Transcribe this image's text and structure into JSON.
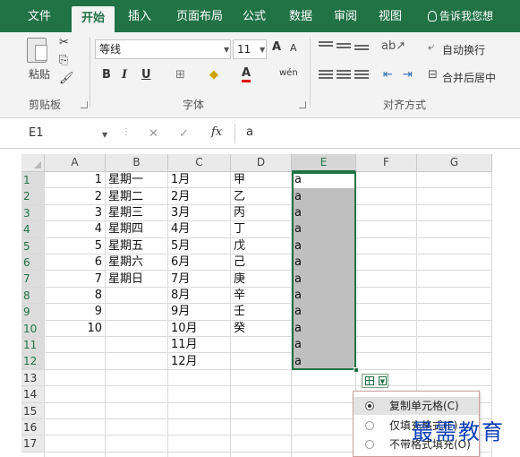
{
  "ribbon_tabs": [
    {
      "label": "文件"
    },
    {
      "label": "开始",
      "active": true
    },
    {
      "label": "插入"
    },
    {
      "label": "页面布局"
    },
    {
      "label": "公式"
    },
    {
      "label": "数据"
    },
    {
      "label": "审阅"
    },
    {
      "label": "视图"
    }
  ],
  "tell_me": "告诉我您想",
  "clipboard": {
    "paste_label": "粘贴",
    "group_label": "剪贴板"
  },
  "font": {
    "name": "等线",
    "size": "11",
    "group_label": "字体",
    "bold": "B",
    "italic": "I",
    "underline": "U",
    "grow": "A",
    "shrink": "A",
    "color_letter": "A",
    "phonetic": "wén"
  },
  "alignment": {
    "wrap_text": "自动换行",
    "merge_center": "合并后居中",
    "group_label": "对齐方式"
  },
  "formula_bar": {
    "name_box": "E1",
    "fx": "fx",
    "value": "a"
  },
  "columns": [
    "A",
    "B",
    "C",
    "D",
    "E",
    "F",
    "G"
  ],
  "selected_column": "E",
  "rows": [
    {
      "n": "1",
      "a": "1",
      "b": "星期一",
      "c": "1月",
      "d": "甲",
      "e": "a"
    },
    {
      "n": "2",
      "a": "2",
      "b": "星期二",
      "c": "2月",
      "d": "乙",
      "e": "a"
    },
    {
      "n": "3",
      "a": "3",
      "b": "星期三",
      "c": "3月",
      "d": "丙",
      "e": "a"
    },
    {
      "n": "4",
      "a": "4",
      "b": "星期四",
      "c": "4月",
      "d": "丁",
      "e": "a"
    },
    {
      "n": "5",
      "a": "5",
      "b": "星期五",
      "c": "5月",
      "d": "戊",
      "e": "a"
    },
    {
      "n": "6",
      "a": "6",
      "b": "星期六",
      "c": "6月",
      "d": "己",
      "e": "a"
    },
    {
      "n": "7",
      "a": "7",
      "b": "星期日",
      "c": "7月",
      "d": "庚",
      "e": "a"
    },
    {
      "n": "8",
      "a": "8",
      "b": "",
      "c": "8月",
      "d": "辛",
      "e": "a"
    },
    {
      "n": "9",
      "a": "9",
      "b": "",
      "c": "9月",
      "d": "壬",
      "e": "a"
    },
    {
      "n": "10",
      "a": "10",
      "b": "",
      "c": "10月",
      "d": "癸",
      "e": "a"
    },
    {
      "n": "11",
      "a": "",
      "b": "",
      "c": "11月",
      "d": "",
      "e": "a"
    },
    {
      "n": "12",
      "a": "",
      "b": "",
      "c": "12月",
      "d": "",
      "e": "a"
    },
    {
      "n": "13",
      "a": "",
      "b": "",
      "c": "",
      "d": "",
      "e": ""
    },
    {
      "n": "14",
      "a": "",
      "b": "",
      "c": "",
      "d": "",
      "e": ""
    },
    {
      "n": "15",
      "a": "",
      "b": "",
      "c": "",
      "d": "",
      "e": ""
    },
    {
      "n": "16",
      "a": "",
      "b": "",
      "c": "",
      "d": "",
      "e": ""
    },
    {
      "n": "17",
      "a": "",
      "b": "",
      "c": "",
      "d": "",
      "e": ""
    }
  ],
  "autofill_menu": {
    "items": [
      {
        "label": "复制单元格(C)",
        "selected": true
      },
      {
        "label": "仅填充格式(F)",
        "selected": false
      },
      {
        "label": "不带格式填充(O)",
        "selected": false
      }
    ]
  },
  "watermark": "最需教育",
  "colors": {
    "accent": "#217346",
    "selection": "#bfbfbf",
    "watermark": "#0b3fb5"
  }
}
